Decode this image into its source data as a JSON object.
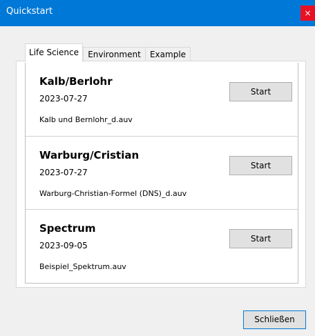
{
  "window": {
    "title": "Quickstart",
    "close_glyph": "×"
  },
  "tabs": [
    {
      "label": "Life Science",
      "active": true
    },
    {
      "label": "Environment",
      "active": false
    },
    {
      "label": "Example",
      "active": false
    }
  ],
  "items": [
    {
      "title": "Kalb/Berlohr",
      "date": "2023-07-27",
      "file": "Kalb und Bernlohr_d.auv",
      "button": "Start"
    },
    {
      "title": "Warburg/Cristian",
      "date": "2023-07-27",
      "file": "Warburg-Christian-Formel (DNS)_d.auv",
      "button": "Start"
    },
    {
      "title": "Spectrum",
      "date": "2023-09-05",
      "file": "Beispiel_Spektrum.auv",
      "button": "Start"
    }
  ],
  "footer": {
    "close_label": "Schließen"
  },
  "colors": {
    "titlebar": "#0078d7",
    "close": "#e81123"
  }
}
